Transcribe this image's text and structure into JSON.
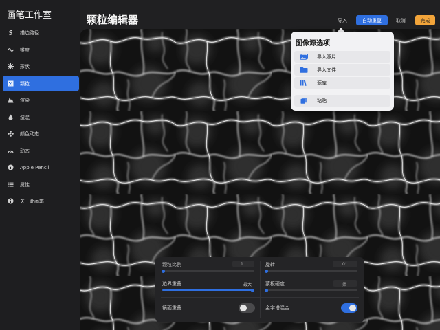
{
  "sidebar": {
    "title": "画笔工作室",
    "items": [
      {
        "label": "描边路径",
        "icon": "stroke-path-icon",
        "glyph": "ꟗ",
        "active": false
      },
      {
        "label": "锥度",
        "icon": "taper-icon",
        "glyph": "〜",
        "active": false
      },
      {
        "label": "形状",
        "icon": "shape-icon",
        "glyph": "✸",
        "active": false
      },
      {
        "label": "颗粒",
        "icon": "grain-icon",
        "glyph": "▦",
        "active": true
      },
      {
        "label": "渲染",
        "icon": "rendering-icon",
        "glyph": "◭",
        "active": false
      },
      {
        "label": "湿混",
        "icon": "wet-mix-icon",
        "glyph": "💧",
        "active": false
      },
      {
        "label": "颜色动态",
        "icon": "color-dynamics-icon",
        "glyph": "✥",
        "active": false
      },
      {
        "label": "动态",
        "icon": "dynamics-icon",
        "glyph": "◠",
        "active": false
      },
      {
        "label": "Apple Pencil",
        "icon": "apple-pencil-icon",
        "glyph": "ⓘ",
        "active": false
      },
      {
        "label": "属性",
        "icon": "properties-icon",
        "glyph": "☰",
        "active": false
      },
      {
        "label": "关于此画笔",
        "icon": "about-brush-icon",
        "glyph": "ⓘ",
        "active": false
      }
    ]
  },
  "header": {
    "title": "颗粒编辑器",
    "import_label": "导入",
    "autorepeat_label": "自动重复",
    "cancel_label": "取消",
    "done_label": "完成"
  },
  "popover": {
    "title": "图像源选项",
    "items": [
      {
        "label": "导入照片",
        "icon": "photo-icon"
      },
      {
        "label": "导入文件",
        "icon": "folder-icon"
      },
      {
        "label": "源库",
        "icon": "library-icon"
      },
      {
        "label": "粘贴",
        "icon": "paste-icon"
      }
    ]
  },
  "panel": {
    "grain_scale": {
      "label": "颗粒比例",
      "value": "1",
      "level": 0.0
    },
    "rotation": {
      "label": "旋转",
      "value": "0°",
      "level": 0.0
    },
    "edge_overlap": {
      "label": "边界重叠",
      "value": "最大",
      "level": 1.0
    },
    "mask_hardness": {
      "label": "蒙板硬度",
      "value": "柔",
      "level": 0.0
    },
    "mirror_overlap": {
      "label": "镜面重叠",
      "on": false
    },
    "pyramid_blend": {
      "label": "金字塔混合",
      "on": true
    }
  },
  "colors": {
    "accent": "#2f6fe0",
    "done": "#f2a43a",
    "sidebar_bg": "#1e1e20",
    "canvas_bg": "#0d0d0d"
  }
}
